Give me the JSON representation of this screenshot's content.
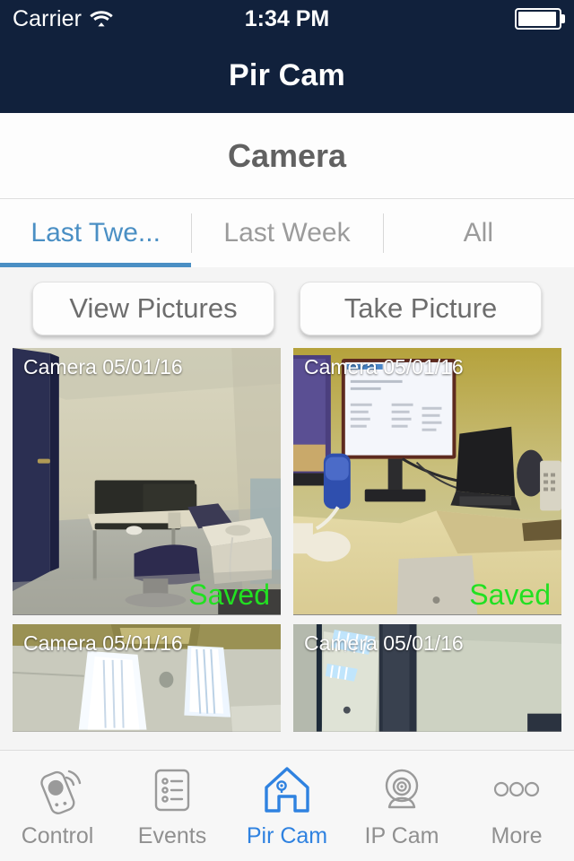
{
  "status_bar": {
    "carrier": "Carrier",
    "wifi_icon": "wifi-icon",
    "time": "1:34 PM",
    "battery_icon": "battery-icon"
  },
  "nav_bar": {
    "title": "Pir Cam"
  },
  "section": {
    "title": "Camera"
  },
  "filter_tabs": {
    "items": [
      {
        "label": "Last Twe...",
        "active": true
      },
      {
        "label": "Last Week",
        "active": false
      },
      {
        "label": "All",
        "active": false
      }
    ]
  },
  "actions": {
    "view_pictures_label": "View Pictures",
    "take_picture_label": "Take Picture"
  },
  "gallery": {
    "rows": [
      {
        "items": [
          {
            "caption": "Camera 05/01/16",
            "status": "Saved",
            "scene": "office-room"
          },
          {
            "caption": "Camera 05/01/16",
            "status": "Saved",
            "scene": "desk-closeup"
          }
        ]
      },
      {
        "items": [
          {
            "caption": "Camera 05/01/16",
            "status": "",
            "scene": "window-light"
          },
          {
            "caption": "Camera 05/01/16",
            "status": "",
            "scene": "corridor-ceiling"
          }
        ]
      }
    ]
  },
  "tab_bar": {
    "items": [
      {
        "label": "Control",
        "icon": "remote-control-icon",
        "active": false
      },
      {
        "label": "Events",
        "icon": "list-document-icon",
        "active": false
      },
      {
        "label": "Pir Cam",
        "icon": "house-sensor-icon",
        "active": true
      },
      {
        "label": "IP Cam",
        "icon": "webcam-icon",
        "active": false
      },
      {
        "label": "More",
        "icon": "three-dots-icon",
        "active": false
      }
    ]
  },
  "colors": {
    "nav_background": "#11213c",
    "accent_blue": "#4a8fc4",
    "tabbar_active": "#2f82e0",
    "status_green": "#22e022",
    "content_background": "#f4f4f4"
  }
}
